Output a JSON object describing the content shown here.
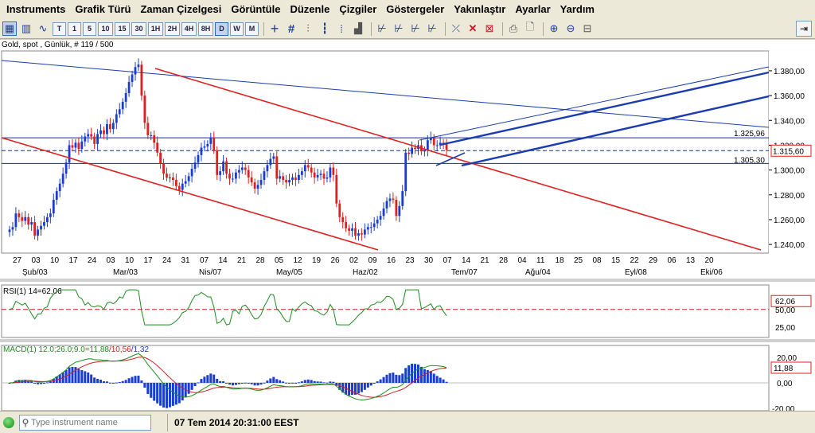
{
  "menu": [
    "Instruments",
    "Grafik Türü",
    "Zaman Çizelgesi",
    "Görüntüle",
    "Düzenle",
    "Çizgiler",
    "Göstergeler",
    "Yakınlaştır",
    "Ayarlar",
    "Yardım"
  ],
  "toolbar": {
    "timeframes": [
      "T",
      "1",
      "5",
      "10",
      "15",
      "30",
      "1H",
      "2H",
      "4H",
      "8H",
      "D",
      "W",
      "M"
    ],
    "selected_timeframe": "D",
    "icons": [
      "crosshair-icon",
      "grid-icon",
      "bar-chart-icon",
      "candle-chart-icon",
      "line-chart-icon",
      "area-chart-icon",
      "fork-icon-1",
      "fork-icon-2",
      "fork-icon-3",
      "fork-icon-4",
      "delete-line-icon",
      "delete-icon",
      "delete-all-icon",
      "print-icon",
      "print-preview-icon",
      "zoom-in-icon",
      "zoom-out-icon",
      "zoom-fit-icon"
    ]
  },
  "chart": {
    "title": "Gold, spot , Günlük, # 119 / 500",
    "price_ticks": [
      "1.380,00",
      "1.360,00",
      "1.340,00",
      "1.320,00",
      "1.300,00",
      "1.280,00",
      "1.260,00",
      "1.240,00"
    ],
    "marker_labels": {
      "upper": "1.325,96",
      "current": "1.315,60",
      "lower": "1.305,30"
    },
    "date_ticks": [
      "27",
      "03",
      "10",
      "17",
      "24",
      "03",
      "10",
      "17",
      "24",
      "31",
      "07",
      "14",
      "21",
      "28",
      "05",
      "12",
      "19",
      "26",
      "02",
      "09",
      "16",
      "23",
      "30",
      "07",
      "14",
      "21",
      "28",
      "04",
      "11",
      "18",
      "25",
      "08",
      "15",
      "22",
      "29",
      "06",
      "13",
      "20"
    ],
    "month_labels": [
      "Şub/03",
      "Mar/03",
      "Nis/07",
      "May/05",
      "Haz/02",
      "Tem/07",
      "Ağu/04",
      "Eyl/08",
      "Eki/06"
    ],
    "rsi": {
      "label": "RSI(1) 14=62,06",
      "ticks": [
        "50,00",
        "25,00"
      ],
      "current": "62,06"
    },
    "macd": {
      "label_prefix": "MACD(1) 12.0;26.0;9.0=11,88",
      "label_mid": "/10,56",
      "label_suffix": "/1,32",
      "ticks": [
        "20,00",
        "0,00",
        "-20,00"
      ],
      "current": "11,88"
    },
    "colors": {
      "bull": "#1a3cd0",
      "bear": "#e02020",
      "trend_red": "#e02020",
      "trend_blue": "#1a3cb0",
      "rsi_line": "#1e8a1e",
      "macd_signal": "#cc2222",
      "macd_line": "#1e8a1e",
      "macd_hist": "#1a3cd0"
    }
  },
  "chart_data": {
    "type": "candlestick",
    "series": [
      {
        "name": "Gold, spot",
        "values": [
          1252,
          1254,
          1265,
          1262,
          1259,
          1262,
          1256,
          1258,
          1247,
          1252,
          1255,
          1258,
          1262,
          1265,
          1276,
          1283,
          1289,
          1297,
          1306,
          1320,
          1318,
          1322,
          1317,
          1323,
          1327,
          1329,
          1327,
          1321,
          1329,
          1332,
          1329,
          1337,
          1333,
          1338,
          1345,
          1349,
          1355,
          1362,
          1371,
          1377,
          1383,
          1385,
          1360,
          1338,
          1328,
          1328,
          1322,
          1314,
          1305,
          1297,
          1294,
          1294,
          1292,
          1287,
          1284,
          1289,
          1291,
          1295,
          1301,
          1306,
          1312,
          1318,
          1319,
          1321,
          1326,
          1316,
          1296,
          1299,
          1307,
          1297,
          1293,
          1293,
          1298,
          1300,
          1302,
          1300,
          1294,
          1290,
          1285,
          1288,
          1292,
          1299,
          1304,
          1309,
          1311,
          1293,
          1295,
          1292,
          1290,
          1292,
          1294,
          1292,
          1296,
          1299,
          1304,
          1302,
          1298,
          1294,
          1296,
          1297,
          1293,
          1294,
          1302,
          1296,
          1273,
          1262,
          1258,
          1253,
          1251,
          1253,
          1247,
          1249,
          1248,
          1252,
          1254,
          1254,
          1257,
          1260,
          1263,
          1269,
          1275,
          1277,
          1276,
          1263,
          1271,
          1283,
          1314,
          1313,
          1318,
          1317,
          1320,
          1315,
          1316,
          1324,
          1326,
          1320,
          1320,
          1322,
          1321,
          1316
        ]
      }
    ],
    "ylim": [
      1233,
      1396
    ],
    "rsi_current": 62.06,
    "macd_current": [
      11.88,
      10.56,
      1.32
    ]
  },
  "status": {
    "search_placeholder": "Type instrument name",
    "datetime": "07 Tem 2014 20:31:00 EEST"
  }
}
